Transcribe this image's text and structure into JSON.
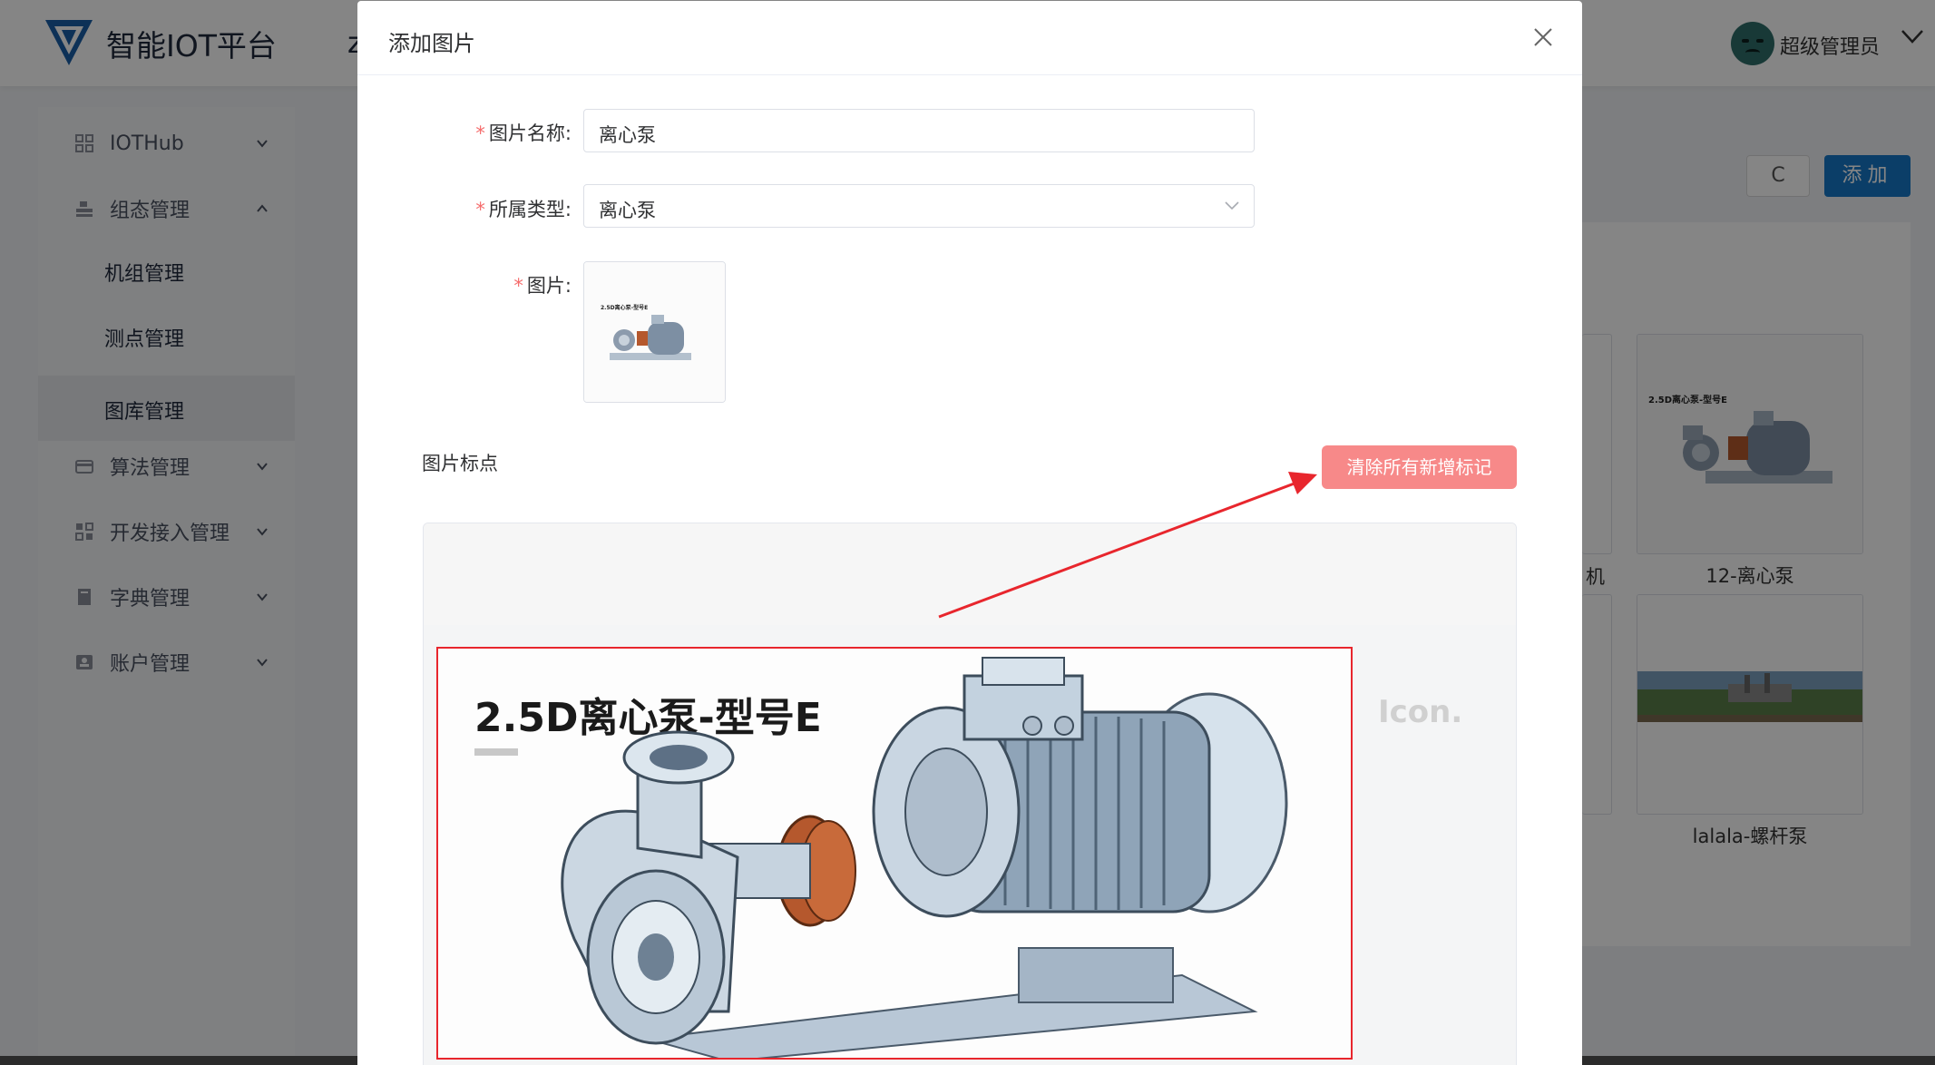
{
  "app": {
    "title": "智能IOT平台",
    "nav_partial": "z",
    "user_name": "超级管理员"
  },
  "sidebar": {
    "items": [
      {
        "label": "IOTHub",
        "icon": "grid-icon",
        "expanded": false
      },
      {
        "label": "组态管理",
        "icon": "stack-icon",
        "expanded": true
      },
      {
        "label": "算法管理",
        "icon": "card-icon",
        "expanded": false
      },
      {
        "label": "开发接入管理",
        "icon": "apps-icon",
        "expanded": false
      },
      {
        "label": "字典管理",
        "icon": "book-icon",
        "expanded": false
      },
      {
        "label": "账户管理",
        "icon": "id-card-icon",
        "expanded": false
      }
    ],
    "sub_items": [
      {
        "label": "机组管理",
        "active": false
      },
      {
        "label": "测点管理",
        "active": false
      },
      {
        "label": "图库管理",
        "active": true
      }
    ]
  },
  "toolbar": {
    "refresh_label": "C",
    "add_label": "添加"
  },
  "gallery": {
    "cards": [
      {
        "caption": "12-离心泵"
      },
      {
        "caption": "lalala-螺杆泵"
      }
    ],
    "partial_caption": "机"
  },
  "modal": {
    "title": "添加图片",
    "fields": {
      "name_label": "图片名称:",
      "name_value": "离心泵",
      "type_label": "所属类型:",
      "type_value": "离心泵",
      "image_label": "图片:"
    },
    "marking": {
      "section_label": "图片标点",
      "clear_button": "清除所有新增标记"
    },
    "preview": {
      "heading": "2.5D离心泵-型号E",
      "watermark": "Icon.",
      "thumb_heading": "2.5D离心泵-型号E"
    }
  },
  "colors": {
    "primary": "#1677c8",
    "danger_light": "#f78989",
    "mark_red": "#e8262d",
    "required": "#f56c6c"
  }
}
